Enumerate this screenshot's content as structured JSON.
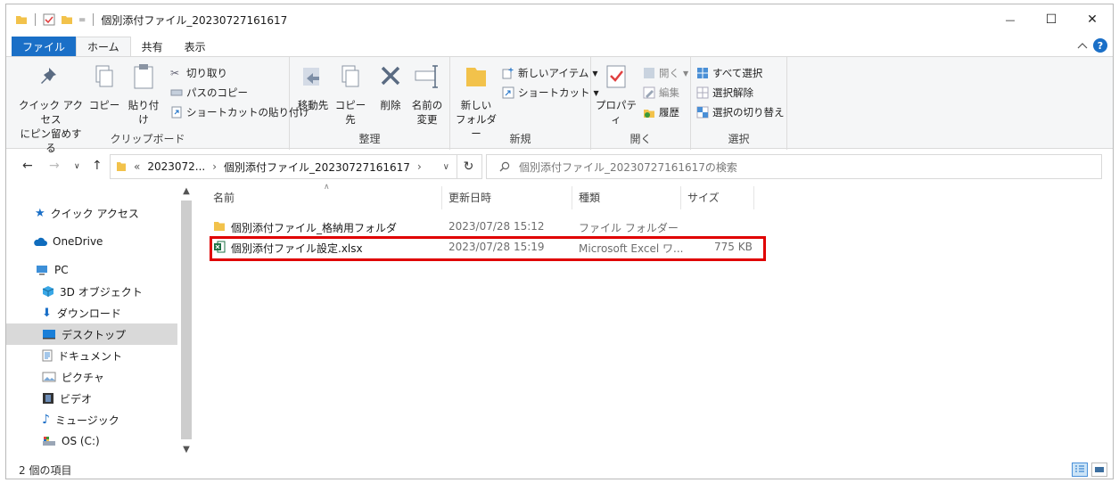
{
  "window": {
    "title": "個別添付ファイル_20230727161617",
    "minimize": "—",
    "maximize": "☐",
    "close": "✕",
    "qat_dropdown": "="
  },
  "tabs": [
    "ファイル",
    "ホーム",
    "共有",
    "表示"
  ],
  "ribbon": {
    "clipboard": {
      "label": "クリップボード",
      "pin_line1": "クイック アクセス",
      "pin_line2": "にピン留めする",
      "copy": "コピー",
      "paste": "貼り付け",
      "cut": "切り取り",
      "copy_path": "パスのコピー",
      "paste_shortcut": "ショートカットの貼り付け"
    },
    "organize": {
      "label": "整理",
      "move_to": "移動先",
      "copy_to": "コピー先",
      "delete": "削除",
      "rename_line1": "名前の",
      "rename_line2": "変更"
    },
    "new": {
      "label": "新規",
      "new_folder_line1": "新しい",
      "new_folder_line2": "フォルダー",
      "new_item": "新しいアイテム",
      "shortcut": "ショートカット"
    },
    "open": {
      "label": "開く",
      "properties": "プロパティ",
      "open": "開く",
      "edit": "編集",
      "history": "履歴"
    },
    "select": {
      "label": "選択",
      "select_all": "すべて選択",
      "select_none": "選択解除",
      "invert": "選択の切り替え"
    }
  },
  "address": {
    "chevron_left": "«",
    "crumb1": "2023072...",
    "crumb2": "個別添付ファイル_20230727161617",
    "search_placeholder": "個別添付ファイル_20230727161617の検索"
  },
  "nav": {
    "quick_access": "クイック アクセス",
    "onedrive": "OneDrive",
    "pc": "PC",
    "objects3d": "3D オブジェクト",
    "downloads": "ダウンロード",
    "desktop": "デスクトップ",
    "documents": "ドキュメント",
    "pictures": "ピクチャ",
    "videos": "ビデオ",
    "music": "ミュージック",
    "os": "OS (C:)"
  },
  "columns": {
    "name": "名前",
    "modified": "更新日時",
    "type": "種類",
    "size": "サイズ"
  },
  "files": [
    {
      "name": "個別添付ファイル_格納用フォルダ",
      "modified": "2023/07/28 15:12",
      "type": "ファイル フォルダー",
      "size": ""
    },
    {
      "name": "個別添付ファイル設定.xlsx",
      "modified": "2023/07/28 15:19",
      "type": "Microsoft Excel ワ...",
      "size": "775 KB"
    }
  ],
  "status": {
    "count": "2 個の項目"
  },
  "colors": {
    "accent": "#1a6fc7",
    "highlight": "#e00000",
    "folder": "#f2c24b",
    "excel": "#1e7145"
  }
}
